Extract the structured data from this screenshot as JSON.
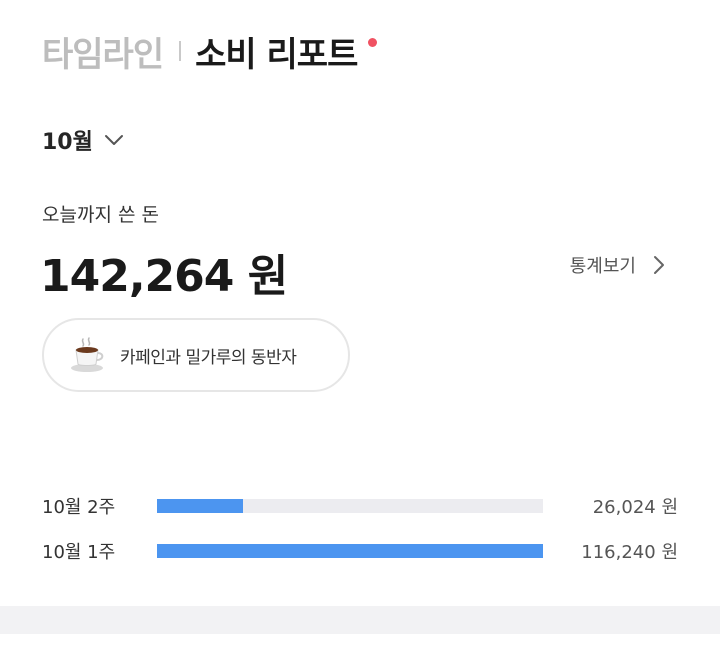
{
  "header": {
    "tab_timeline": "타임라인",
    "tab_report": "소비 리포트",
    "dot_color": "#f05262"
  },
  "month_selector": {
    "label": "10월",
    "icon": "chevron-down-icon"
  },
  "summary": {
    "spent_label": "오늘까지 쓴 돈",
    "spent_amount": "142,264 원",
    "stats_label": "통계보기",
    "stats_icon": "chevron-right-icon"
  },
  "badge": {
    "icon": "coffee-icon",
    "text": "카페인과 밀가루의 동반자"
  },
  "weeks": [
    {
      "label": "10월 2주",
      "amount": "26,024 원",
      "fill_fraction": 0.2239
    },
    {
      "label": "10월 1주",
      "amount": "116,240 원",
      "fill_fraction": 1.0
    }
  ],
  "colors": {
    "bar_fill": "#4c95f0",
    "bar_track": "#ececf0",
    "footer_band": "#f2f2f4"
  }
}
